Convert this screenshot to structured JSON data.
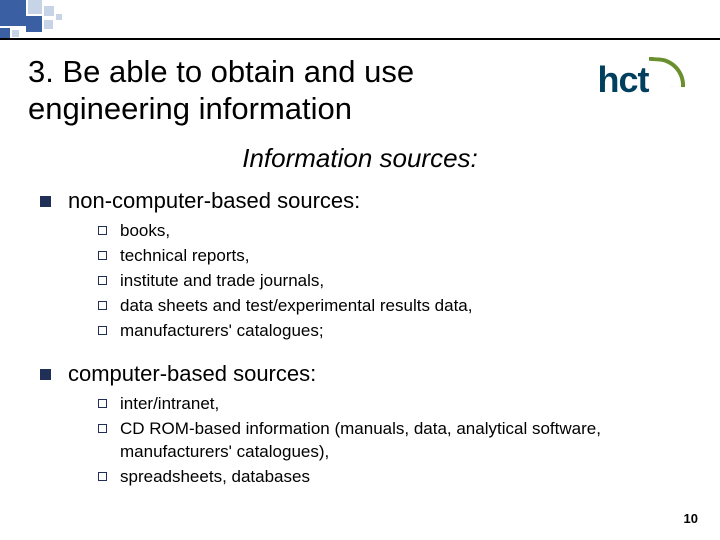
{
  "deco_color_dark": "#3b5fa3",
  "deco_color_light": "#c7d4e7",
  "logo": {
    "text": "hct",
    "text_color": "#003f5e",
    "arc_color": "#6a8f2f"
  },
  "title": "3. Be able to obtain and use engineering information",
  "subtitle": "Information sources:",
  "sections": [
    {
      "heading": "non-computer-based sources:",
      "items": [
        "books,",
        "technical reports,",
        "institute and trade journals,",
        "data sheets and test/experimental results data,",
        "manufacturers' catalogues;"
      ]
    },
    {
      "heading": "computer-based sources:",
      "items": [
        "inter/intranet,",
        "CD ROM-based information (manuals, data, analytical software, manufacturers' catalogues),",
        "spreadsheets, databases"
      ]
    }
  ],
  "page_number": "10"
}
